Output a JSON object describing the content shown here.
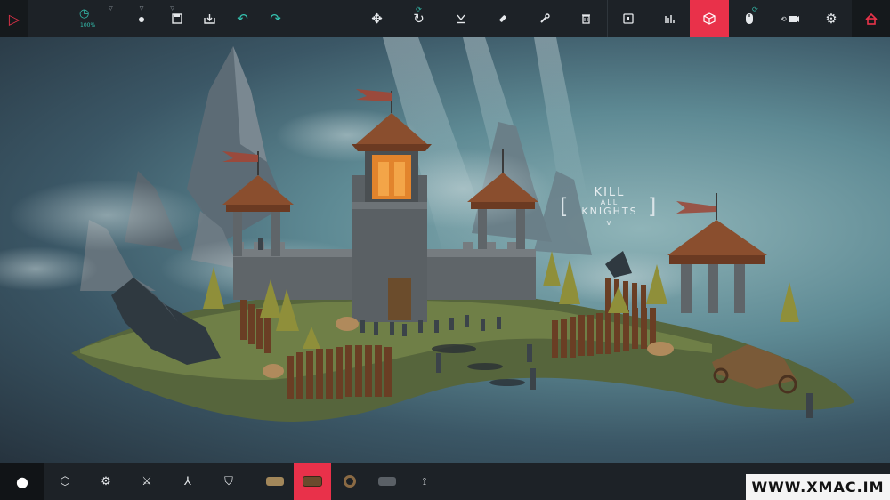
{
  "top_toolbar": {
    "timescale_percent": "100%",
    "timescale_value": 0.5,
    "play_icon": "play-icon",
    "left_group": [
      "save-icon",
      "load-icon",
      "undo-icon",
      "redo-icon"
    ],
    "center_group": [
      "move-icon",
      "rotate-icon",
      "mirror-icon",
      "eraser-icon",
      "wrench-icon",
      "trash-icon"
    ],
    "right_group": [
      "frame-icon",
      "stats-icon",
      "block-view-icon",
      "mouse-icon",
      "camera-icon",
      "settings-icon",
      "home-icon"
    ],
    "active_item": "block-view-icon"
  },
  "scene": {
    "banner_line1": "KILL",
    "banner_line2": "ALL",
    "banner_line3": "KNIGHTS",
    "banner_arrow": "v",
    "bracket_left": "[",
    "bracket_right": "]"
  },
  "bottom_toolbar": {
    "categories": [
      "basic-icon",
      "blocks-icon",
      "gears-icon",
      "weapons-icon",
      "flight-icon",
      "armour-icon"
    ],
    "blocks": [
      "wooden-block",
      "log-block",
      "wheel-block",
      "cannon-block",
      "grabber-block"
    ],
    "active_block": "log-block"
  },
  "watermark": "WWW.XMAC.IM",
  "colors": {
    "accent": "#e9314a",
    "teal": "#35c2b0",
    "toolbar": "#1d2227"
  }
}
